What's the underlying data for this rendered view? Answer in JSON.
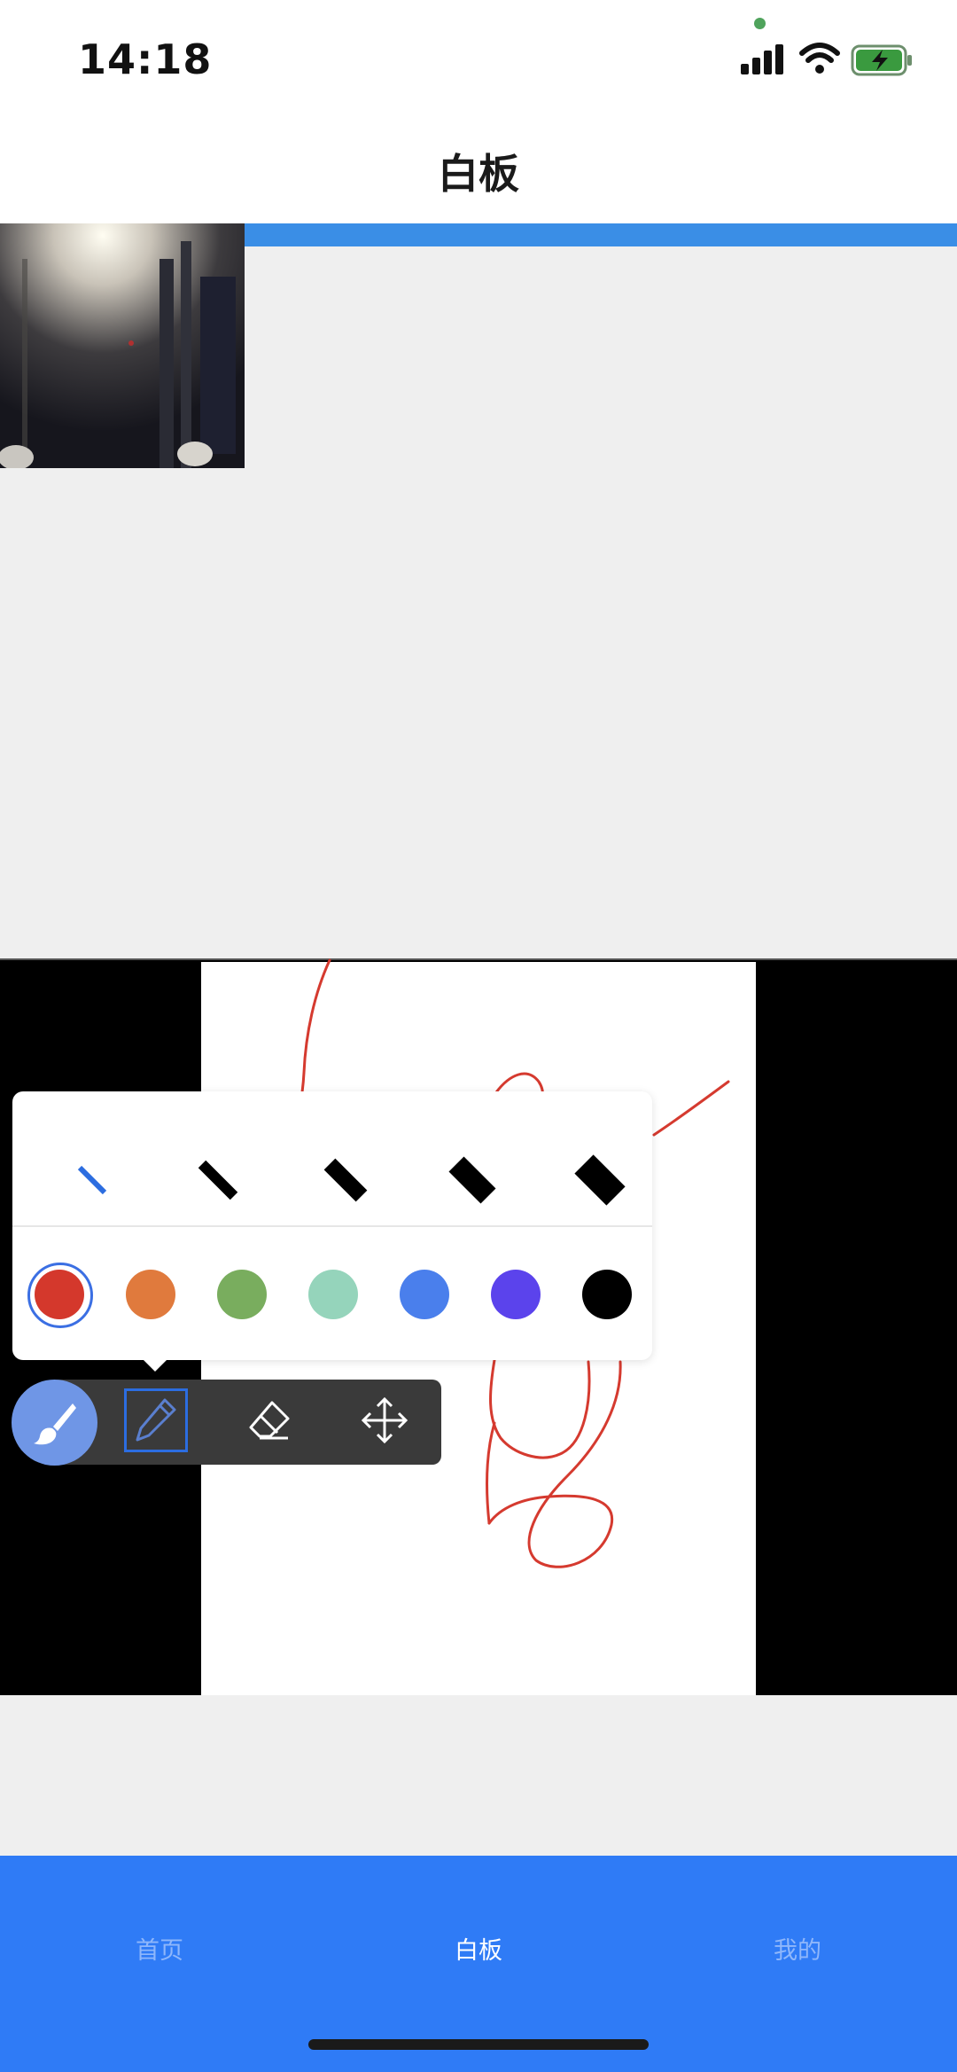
{
  "status_bar": {
    "time": "14:18"
  },
  "nav": {
    "title": "白板"
  },
  "palette": {
    "selected_size_index": 0,
    "selected_color_index": 0,
    "colors": [
      "#d4382c",
      "#e07a3d",
      "#79ad5e",
      "#95d4bb",
      "#4a7fec",
      "#5b43ec",
      "#000000"
    ]
  },
  "toolbar": {
    "tools": [
      "brush-icon",
      "pencil-icon",
      "eraser-icon",
      "move-icon"
    ],
    "active_tool": "pencil-icon"
  },
  "tabs": [
    {
      "label": "首页",
      "active": false
    },
    {
      "label": "白板",
      "active": true
    },
    {
      "label": "我的",
      "active": false
    }
  ]
}
